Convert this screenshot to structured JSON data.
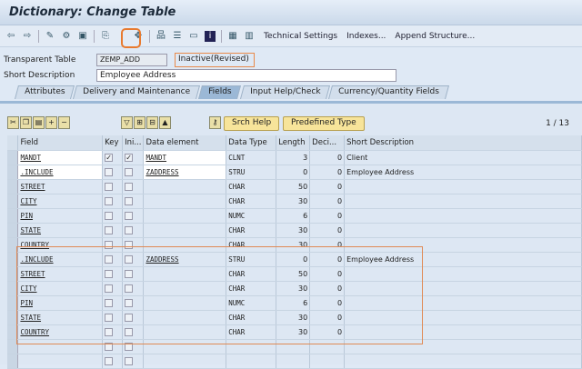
{
  "title": "Dictionary: Change Table",
  "toolbar": {
    "technical_settings": "Technical Settings",
    "indexes": "Indexes...",
    "append_structure": "Append Structure..."
  },
  "form": {
    "table_label": "Transparent Table",
    "table_value": "ZEMP_ADD",
    "status": "Inactive(Revised)",
    "desc_label": "Short Description",
    "desc_value": "Employee Address"
  },
  "tabs": [
    "Attributes",
    "Delivery and Maintenance",
    "Fields",
    "Input Help/Check",
    "Currency/Quantity Fields"
  ],
  "table_toolbar": {
    "srch_help": "Srch Help",
    "predefined_type": "Predefined Type",
    "page": "1 / 13"
  },
  "columns": [
    "Field",
    "Key",
    "Ini...",
    "Data element",
    "Data Type",
    "Length",
    "Deci...",
    "Short Description"
  ],
  "rows": [
    {
      "field": "MANDT",
      "key": true,
      "ini": true,
      "elem": "MANDT",
      "type": "CLNT",
      "len": "3",
      "dec": "0",
      "desc": "Client"
    },
    {
      "field": ".INCLUDE",
      "key": false,
      "ini": false,
      "elem": "ZADDRESS",
      "type": "STRU",
      "len": "0",
      "dec": "0",
      "desc": "Employee Address"
    },
    {
      "field": "STREET",
      "key": false,
      "ini": false,
      "elem": "",
      "type": "CHAR",
      "len": "50",
      "dec": "0",
      "desc": ""
    },
    {
      "field": "CITY",
      "key": false,
      "ini": false,
      "elem": "",
      "type": "CHAR",
      "len": "30",
      "dec": "0",
      "desc": ""
    },
    {
      "field": "PIN",
      "key": false,
      "ini": false,
      "elem": "",
      "type": "NUMC",
      "len": "6",
      "dec": "0",
      "desc": ""
    },
    {
      "field": "STATE",
      "key": false,
      "ini": false,
      "elem": "",
      "type": "CHAR",
      "len": "30",
      "dec": "0",
      "desc": ""
    },
    {
      "field": "COUNTRY",
      "key": false,
      "ini": false,
      "elem": "",
      "type": "CHAR",
      "len": "30",
      "dec": "0",
      "desc": ""
    },
    {
      "field": ".INCLUDE",
      "key": false,
      "ini": false,
      "elem": "ZADDRESS",
      "type": "STRU",
      "len": "0",
      "dec": "0",
      "desc": "Employee Address"
    },
    {
      "field": "STREET",
      "key": false,
      "ini": false,
      "elem": "",
      "type": "CHAR",
      "len": "50",
      "dec": "0",
      "desc": ""
    },
    {
      "field": "CITY",
      "key": false,
      "ini": false,
      "elem": "",
      "type": "CHAR",
      "len": "30",
      "dec": "0",
      "desc": ""
    },
    {
      "field": "PIN",
      "key": false,
      "ini": false,
      "elem": "",
      "type": "NUMC",
      "len": "6",
      "dec": "0",
      "desc": ""
    },
    {
      "field": "STATE",
      "key": false,
      "ini": false,
      "elem": "",
      "type": "CHAR",
      "len": "30",
      "dec": "0",
      "desc": ""
    },
    {
      "field": "COUNTRY",
      "key": false,
      "ini": false,
      "elem": "",
      "type": "CHAR",
      "len": "30",
      "dec": "0",
      "desc": ""
    },
    {
      "field": "",
      "key": false,
      "ini": false,
      "elem": "",
      "type": "",
      "len": "",
      "dec": "",
      "desc": ""
    },
    {
      "field": "",
      "key": false,
      "ini": false,
      "elem": "",
      "type": "",
      "len": "",
      "dec": "",
      "desc": ""
    }
  ]
}
